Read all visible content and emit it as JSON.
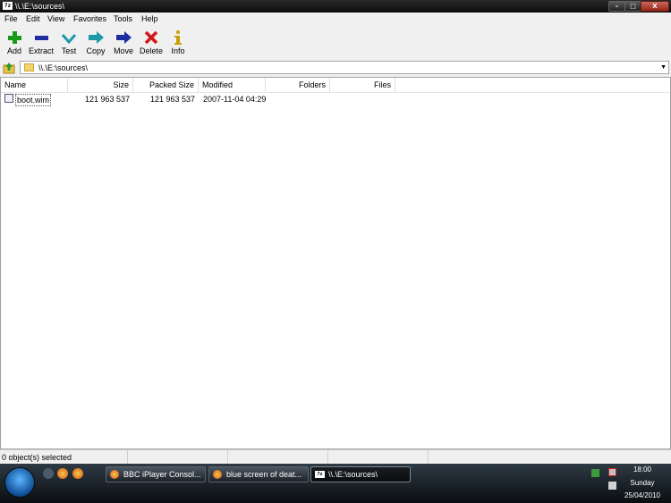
{
  "window": {
    "title": "\\\\.\\E:\\sources\\",
    "app_icon_text": "7z"
  },
  "window_controls": {
    "minimize": "–",
    "maximize": "□",
    "close": "X"
  },
  "menu": [
    "File",
    "Edit",
    "View",
    "Favorites",
    "Tools",
    "Help"
  ],
  "toolbar": [
    {
      "label": "Add",
      "icon": "plus-icon",
      "color": "#1a9a1a"
    },
    {
      "label": "Extract",
      "icon": "minus-icon",
      "color": "#1d2fa0"
    },
    {
      "label": "Test",
      "icon": "check-icon",
      "color": "#1d9aa8"
    },
    {
      "label": "Copy",
      "icon": "double-arrow-right-icon",
      "color": "#1d9aa8"
    },
    {
      "label": "Move",
      "icon": "arrow-right-icon",
      "color": "#1d2fa0"
    },
    {
      "label": "Delete",
      "icon": "x-icon",
      "color": "#d01818"
    },
    {
      "label": "Info",
      "icon": "info-icon",
      "color": "#c8a000"
    }
  ],
  "address": {
    "path": "\\\\.\\E:\\sources\\"
  },
  "columns": [
    "Name",
    "Size",
    "Packed Size",
    "Modified",
    "Folders",
    "Files"
  ],
  "rows": [
    {
      "name": "boot.wim",
      "size": "121 963 537",
      "packed": "121 963 537",
      "modified": "2007-11-04 04:29"
    }
  ],
  "status": {
    "text": "0 object(s) selected"
  },
  "taskbar": {
    "tasks": [
      {
        "label": "BBC iPlayer Consol...",
        "icon": "firefox-icon"
      },
      {
        "label": "blue screen of deat...",
        "icon": "firefox-icon"
      },
      {
        "label": "\\\\.\\E:\\sources\\",
        "icon": "sevenzip-icon",
        "active": true
      }
    ],
    "clock": {
      "time": "18:00",
      "day": "Sunday",
      "date": "25/04/2010"
    }
  }
}
